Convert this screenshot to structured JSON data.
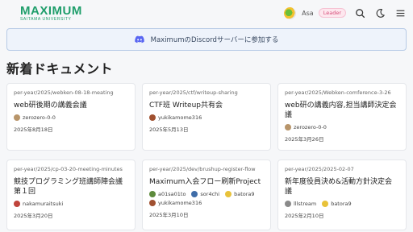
{
  "header": {
    "logo_main": "MAXIMUM",
    "logo_sub": "SAITAMA UNIVERSITY",
    "user_name": "Asa",
    "user_badge": "Leader",
    "icons": [
      "search-icon",
      "moon-icon",
      "hamburger-menu-icon"
    ]
  },
  "banner": {
    "text": "MaximumのDiscordサーバーに参加する",
    "icon": "discord-icon"
  },
  "section_title": "新着ドキュメント",
  "cards": [
    {
      "path": "per-year/2025/webken-08-18-meating",
      "title": "web研後期の講義会議",
      "authors": [
        {
          "name": "zerozero-0-0",
          "color": "#b8956a"
        }
      ],
      "date": "2025年8月18日"
    },
    {
      "path": "per-year/2025/ctf/writeup-sharing",
      "title": "CTF班 Writeup共有会",
      "authors": [
        {
          "name": "yukikamome316",
          "color": "#a05030"
        }
      ],
      "date": "2025年5月13日"
    },
    {
      "path": "per-year/2025/Webken-comference-3-26",
      "title": "web研の講義内容,担当講師決定会議",
      "authors": [
        {
          "name": "zerozero-0-0",
          "color": "#b8956a"
        }
      ],
      "date": "2025年3月26日"
    },
    {
      "path": "per-year/2025/cp-03-20-meeting-minutes",
      "title": "競技プログラミング班講師陣会議 第１回",
      "authors": [
        {
          "name": "nakamuraitsuki",
          "color": "#c0443c"
        }
      ],
      "date": "2025年3月20日"
    },
    {
      "path": "per-year/2025/dev/brushup-register-flow",
      "title": "Maximum入会フロー刷新Project",
      "authors": [
        {
          "name": "a01sa01to",
          "color": "#5d8a3c"
        },
        {
          "name": "sor4chi",
          "color": "#3f6da8"
        },
        {
          "name": "batora9",
          "color": "#e8c23a"
        },
        {
          "name": "yukikamome316",
          "color": "#a05030"
        }
      ],
      "date": "2025年3月10日"
    },
    {
      "path": "per-year/2025/2025-02-07",
      "title": "新年度役員決め&活動方針決定会議",
      "authors": [
        {
          "name": "lllstream",
          "color": "#8a8a8a"
        },
        {
          "name": "batora9",
          "color": "#e8c23a"
        }
      ],
      "date": "2025年2月10日"
    }
  ]
}
